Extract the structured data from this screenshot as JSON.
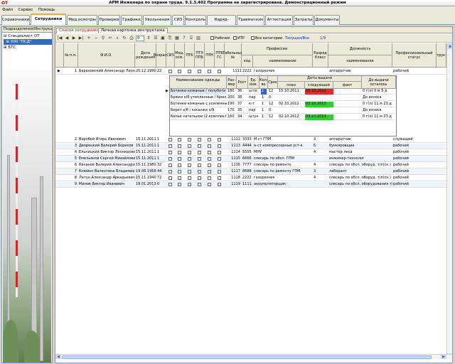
{
  "app": {
    "logo": "OT",
    "title": "АРМ Инженера по охране труда. 9.1.3.402 Программа не зарегистрирована. Демонстрационный режим"
  },
  "menu": [
    "Файл",
    "Сервис",
    "Помощь"
  ],
  "tabs": [
    "Справочники",
    "Сотрудники",
    "Мед.осмотры",
    "Проверка",
    "Графики",
    "Увольнения",
    "СИЗ",
    "Контроль",
    "Наряд-допуск",
    "Травматизм",
    "Аттестация",
    "Затраты",
    "Документы"
  ],
  "left": {
    "tabs_label": "Подразделения/Инструкции",
    "tree": [
      "Специалист ОТ",
      "000 \"ПСД\"",
      "БТС"
    ]
  },
  "subtabs": [
    "Список сотрудников",
    "Личная карточка инструктажа"
  ],
  "toolbar": {
    "counter": "0",
    "workers_label": "Рабочие",
    "itr_label": "ИТР",
    "all_categories_label": "Все категории",
    "filter_label": "Текущая/Все",
    "page_label": "1/9"
  },
  "columns": [
    "№ п.п.",
    "Ф.И.О.",
    "Дата рождения",
    "Возраст",
    "СИЗ",
    "Мед. осм.",
    "ПТБ",
    "ПТЭ ППБ",
    "ПТН",
    "ПТБ ГС",
    "Табельный №",
    "Профессия",
    "код",
    "наименование",
    "Разряд Класс",
    "Должность",
    "наименование",
    "Профессиональный статус",
    "Инструктаж"
  ],
  "employees": [
    {
      "n": "1",
      "fio": "Барановский Александр Леон",
      "dob": "25.12.1990",
      "age": "22",
      "tab": "1111",
      "code": "2222",
      "prof": "газорезчик",
      "rank": "",
      "pos": "аппаратчик",
      "status": "рабочий"
    },
    {
      "n": "2",
      "fio": "Воробей Игорь Иванович",
      "dob": "15.11.2011",
      "age": "1",
      "tab": "1112",
      "code": "3333",
      "prof": "М ст ГПМ",
      "rank": "3",
      "pos": "аппаратчик",
      "status": "служащий"
    },
    {
      "n": "3",
      "fio": "Дворецкий Валерий Борисов",
      "dob": "15.11.2011",
      "age": "1",
      "tab": "1113",
      "code": "4444",
      "prof": "н-ст компрессорных уст-к",
      "rank": "5",
      "pos": "бункеровщик",
      "status": "рабочий"
    },
    {
      "n": "4",
      "fio": "Ельницкий Виктор Леонидович",
      "dob": "15.11.2011",
      "age": "1",
      "tab": "1114",
      "code": "5555",
      "prof": "МНУ",
      "rank": "4",
      "pos": "мастер леса",
      "status": "рабочий"
    },
    {
      "n": "5",
      "fio": "Емельянов Сергей Михайлович",
      "dob": "15.11.2011",
      "age": "1",
      "tab": "1115",
      "code": "6666",
      "prof": "слесарь по обсл. ГПМ",
      "rank": "",
      "pos": "инженер-технолог",
      "status": "рабочий"
    },
    {
      "n": "6",
      "fio": "Качанов Валерий Александро",
      "dob": "15.11.1980",
      "age": "32",
      "tab": "1116",
      "code": "7777",
      "prof": "слесарь по ремонту",
      "rank": "4",
      "pos": "слесарь по обсл. оборуд. т/л(сн.)",
      "status": "рабочий"
    },
    {
      "n": "7",
      "fio": "Клюйко Валентина Владимир",
      "dob": "19.06.1968",
      "age": "44",
      "tab": "1117",
      "code": "8888",
      "prof": "слесарь по ремонту ГПМ",
      "rank": "3",
      "pos": "лаборант",
      "status": "рабочий"
    },
    {
      "n": "8",
      "fio": "Латун Александр Аркадьевич",
      "dob": "15.11.1940",
      "age": "72",
      "tab": "1118",
      "code": "2222",
      "prof": "газорезчик",
      "rank": "4",
      "pos": "слесарь по обсл. оборуд. т/л(сн.)",
      "status": "рабочий"
    },
    {
      "n": "9",
      "fio": "Минов Виктор Иванович",
      "dob": "19.01.2013",
      "age": "0",
      "tab": "1119",
      "code": "1111",
      "prof": "аккумуляторщик",
      "rank": "",
      "pos": "слесарь по обсл. оборудования т/л",
      "status": "рабочий"
    }
  ],
  "siz_headers": {
    "name": "Наименование одежды",
    "size": "Раз- мер",
    "height": "Рост",
    "unit": "Ед. изм.",
    "qty": "Кол- во",
    "term": "Срок",
    "dates": "Даты выдачи",
    "plan": "план",
    "next": "следующей",
    "fact": "факт",
    "remain": "До выдачи осталось"
  },
  "siz": [
    {
      "name": "Ботинки кожаные / полуботи",
      "size": "180",
      "height": "36",
      "unit": "шт/к",
      "qty": "1",
      "term": "12",
      "plan": "15.10.2011",
      "next": "15.10.2012",
      "next_color": "red",
      "fact": "",
      "remain": "0 г(л) 0 м 5 д"
    },
    {
      "name": "Брюки х/б утепленные / брюк",
      "size": "200",
      "height": "38",
      "unit": "пар",
      "qty": "1",
      "term": "0",
      "plan": "",
      "next": "",
      "next_color": "",
      "fact": "",
      "remain": "До износа"
    },
    {
      "name": "Ботинки кожаные с усиленны",
      "size": "190",
      "height": "37",
      "unit": "к-т",
      "qty": "1",
      "term": "12",
      "plan": "02.10.2012",
      "next": "03.10.2013",
      "next_color": "green",
      "fact": "",
      "remain": "0 г(л) 11 м 23 д"
    },
    {
      "name": "Берет х/б / косынка х/б",
      "size": "170",
      "height": "35",
      "unit": "пар",
      "qty": "1",
      "term": "0",
      "plan": "",
      "next": "",
      "next_color": "",
      "fact": "",
      "remain": "До износа"
    },
    {
      "name": "Белье нательное (2 комплект",
      "size": "160",
      "height": "34",
      "unit": "штук",
      "qty": "1",
      "term": "12",
      "plan": "02.10.2012",
      "next": "03.10.2013",
      "next_color": "green",
      "fact": "",
      "remain": "0 г(л) 11 м 23 д"
    }
  ],
  "colors": {
    "accent": "#f2a93b",
    "selection": "#316ac5",
    "overdue": "#e12a2a",
    "ok": "#2dd02d"
  }
}
